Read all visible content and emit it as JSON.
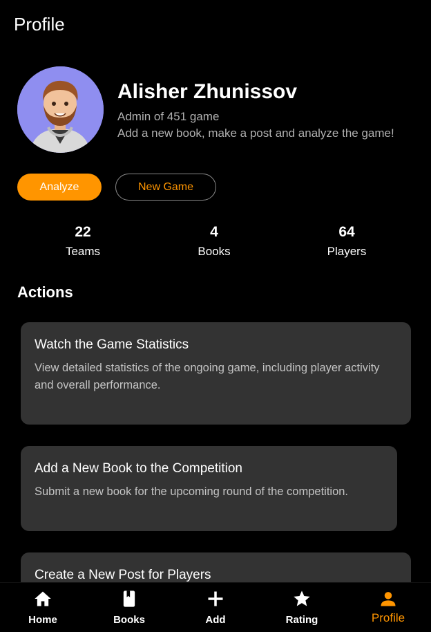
{
  "header": {
    "title": "Profile"
  },
  "profile": {
    "name": "Alisher Zhunissov",
    "role": "Admin of 451 game",
    "description": "Add a new book, make a post and analyze the game!"
  },
  "buttons": {
    "analyze": "Analyze",
    "new_game": "New Game"
  },
  "stats": [
    {
      "value": "22",
      "label": "Teams"
    },
    {
      "value": "4",
      "label": "Books"
    },
    {
      "value": "64",
      "label": "Players"
    }
  ],
  "actions": {
    "title": "Actions",
    "cards": [
      {
        "title": "Watch the Game Statistics",
        "description": "View detailed statistics of the ongoing game, including player activity and overall performance."
      },
      {
        "title": "Add a New Book to the Competition",
        "description": "Submit a new book for the upcoming round of the competition."
      },
      {
        "title": "Create a New Post for Players",
        "description": ""
      }
    ]
  },
  "nav": {
    "items": [
      {
        "label": "Home",
        "icon": "home-icon"
      },
      {
        "label": "Books",
        "icon": "book-icon"
      },
      {
        "label": "Add",
        "icon": "plus-icon"
      },
      {
        "label": "Rating",
        "icon": "star-icon"
      },
      {
        "label": "Profile",
        "icon": "person-icon"
      }
    ],
    "active": "Profile"
  },
  "colors": {
    "accent": "#ff9500",
    "card": "#333333",
    "background": "#000000"
  }
}
